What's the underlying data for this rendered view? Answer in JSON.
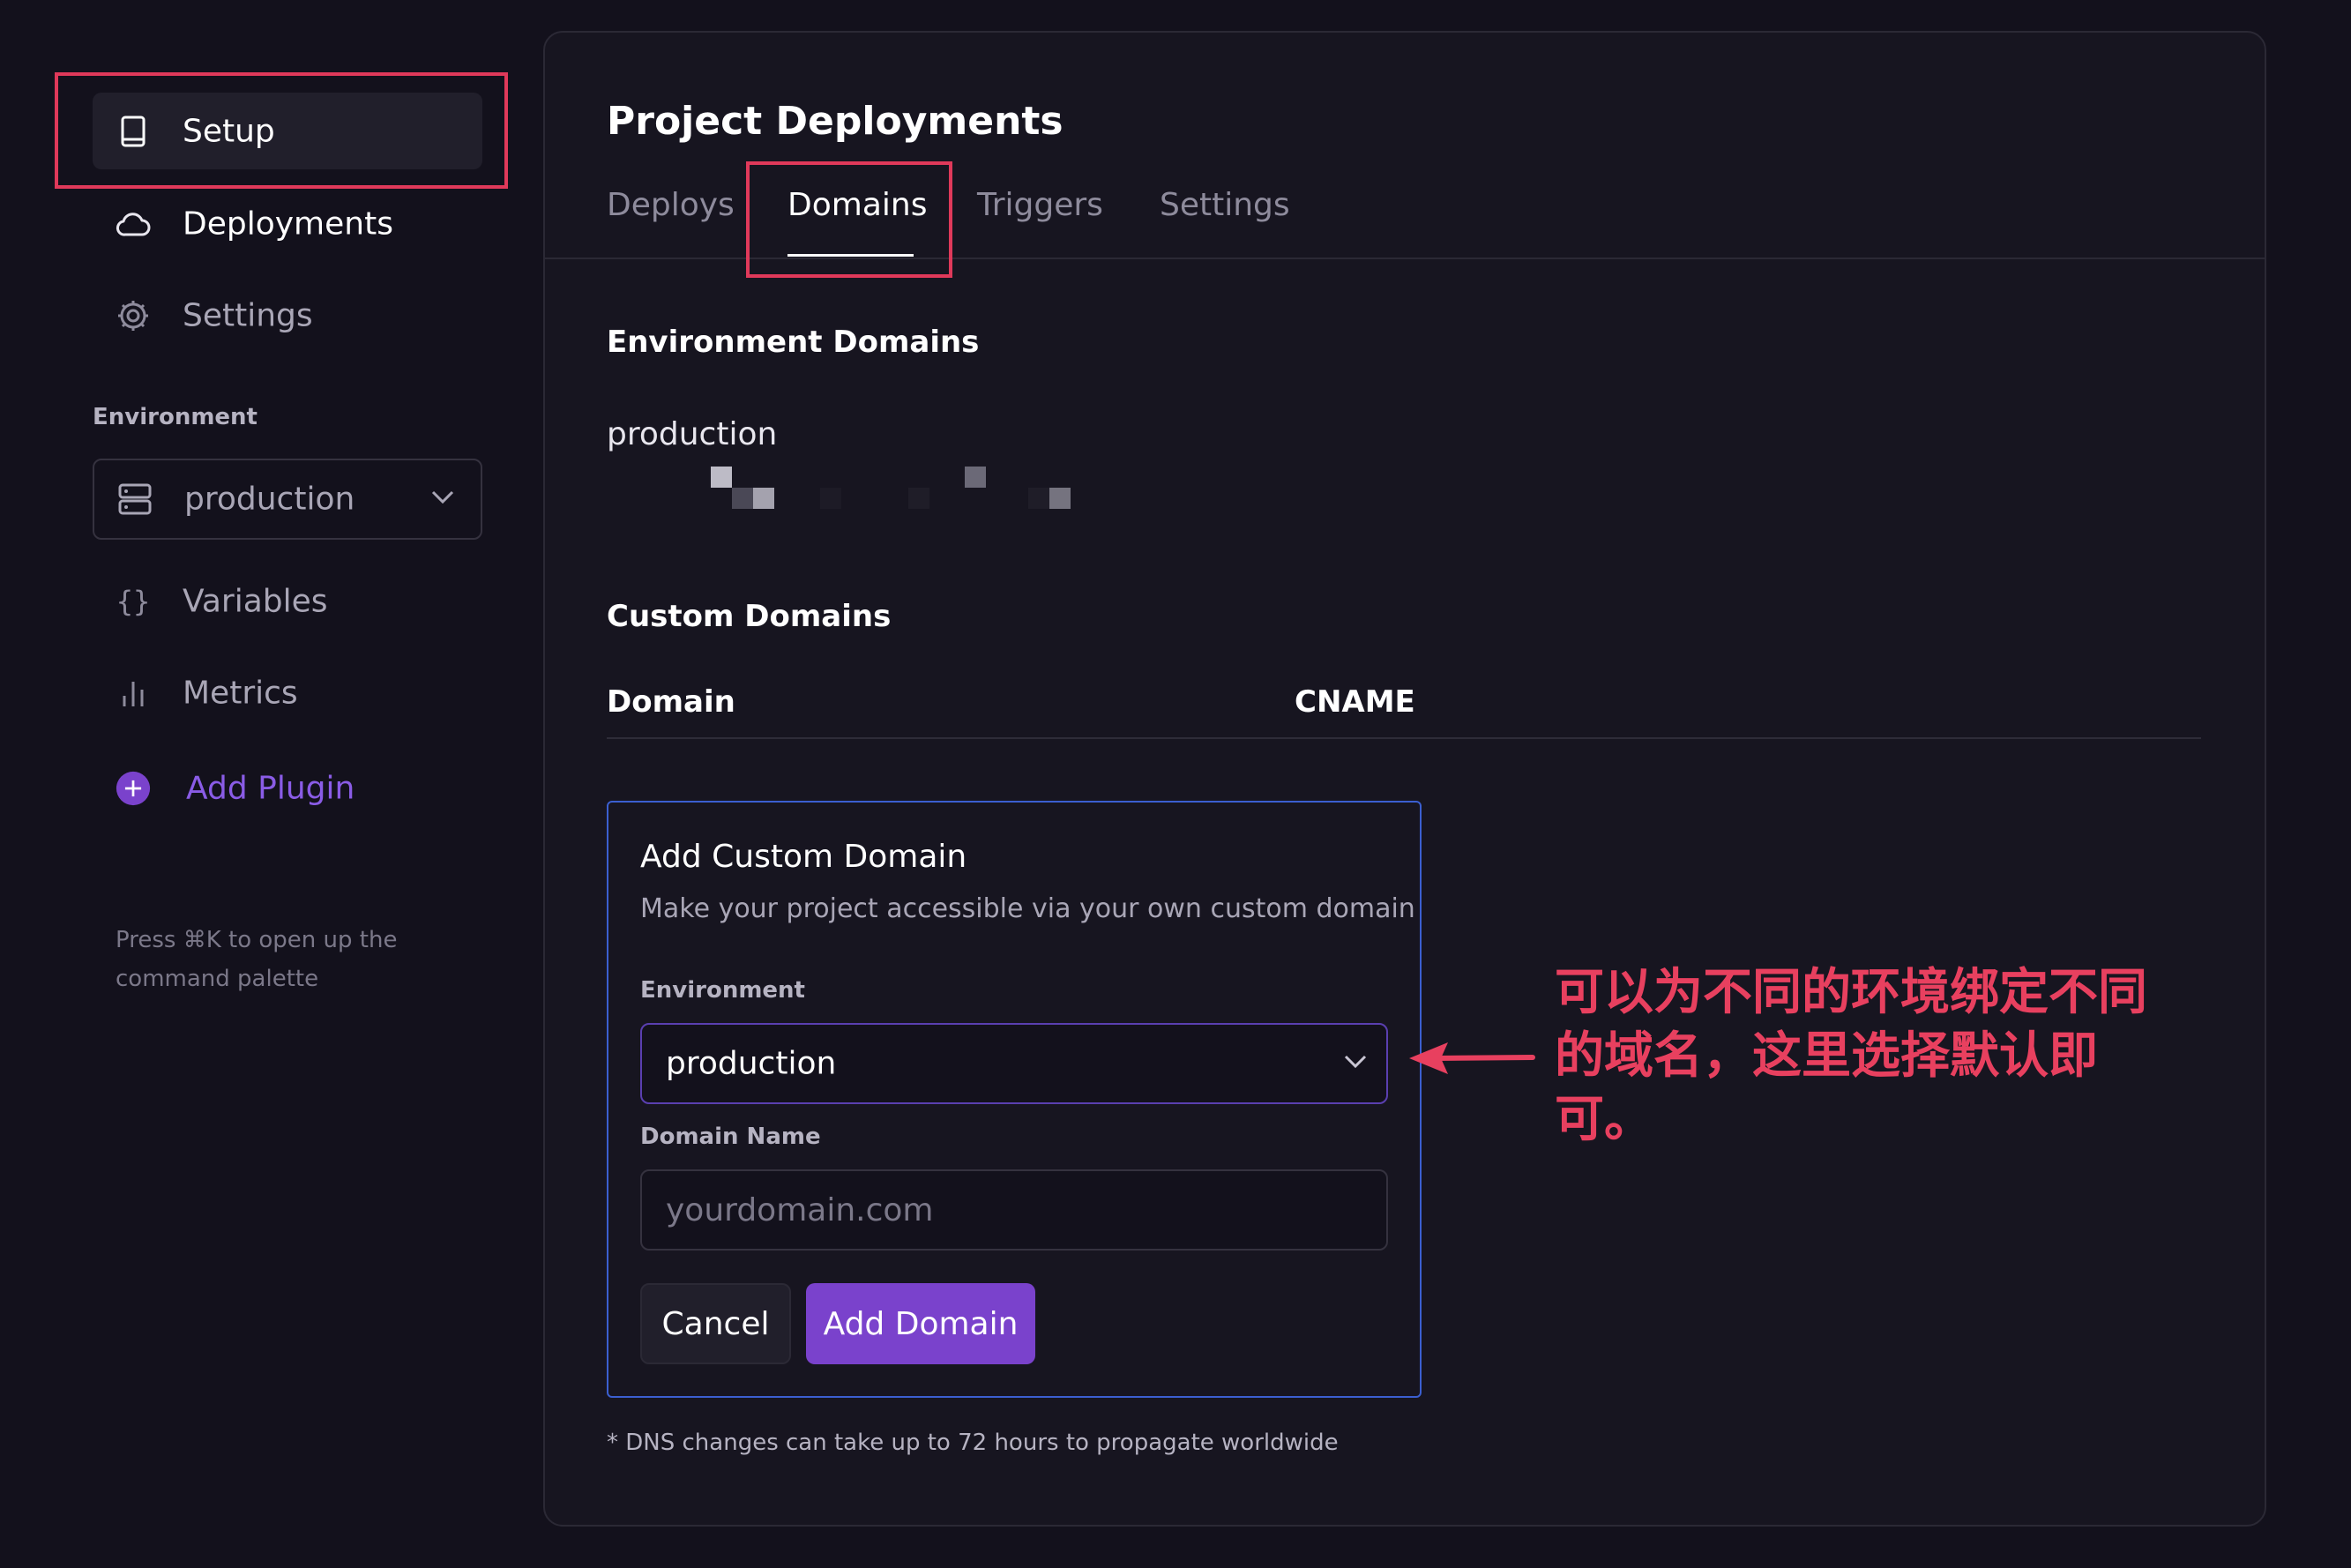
{
  "sidebar": {
    "items": [
      {
        "label": "Setup",
        "icon": "book-icon",
        "active": true
      },
      {
        "label": "Deployments",
        "icon": "cloud-icon"
      },
      {
        "label": "Settings",
        "icon": "gear-icon"
      }
    ],
    "environment_heading": "Environment",
    "environment_selected": "production",
    "env_items": [
      {
        "label": "Variables",
        "icon": "braces-icon"
      },
      {
        "label": "Metrics",
        "icon": "bar-chart-icon"
      }
    ],
    "add_plugin": {
      "label": "Add Plugin",
      "icon": "plus-circle-icon"
    },
    "palette_hint": "Press ⌘K to open up the command palette"
  },
  "main": {
    "title": "Project Deployments",
    "tabs": [
      {
        "label": "Deploys"
      },
      {
        "label": "Domains",
        "active": true
      },
      {
        "label": "Triggers"
      },
      {
        "label": "Settings"
      }
    ],
    "environment_domains": {
      "title": "Environment Domains",
      "environment": "production"
    },
    "custom_domains": {
      "title": "Custom Domains",
      "columns": [
        "Domain",
        "CNAME"
      ]
    },
    "form": {
      "title": "Add Custom Domain",
      "description": "Make your project accessible via your own custom domain",
      "environment_label": "Environment",
      "environment_value": "production",
      "domain_label": "Domain Name",
      "domain_placeholder": "yourdomain.com",
      "cancel_label": "Cancel",
      "submit_label": "Add Domain"
    },
    "dns_note": "* DNS changes can take up to 72 hours to propagate worldwide"
  },
  "annotation": {
    "text": "可以为不同的环境绑定不同的域名，这里选择默认即可。"
  },
  "colors": {
    "background": "#13111c",
    "panel": "#171520",
    "accent_purple": "#7a42cc",
    "highlight_red": "#e0395a",
    "annotation_red": "#e8405f",
    "form_border_blue": "#3b5fd0"
  }
}
